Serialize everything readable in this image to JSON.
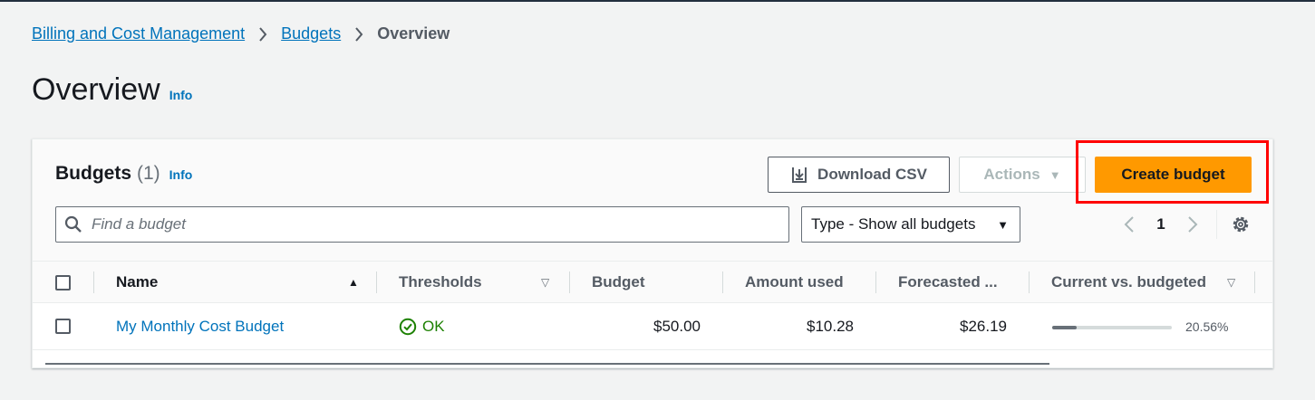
{
  "breadcrumb": {
    "items": [
      "Billing and Cost Management",
      "Budgets"
    ],
    "current": "Overview"
  },
  "page": {
    "title": "Overview",
    "info": "Info"
  },
  "panel": {
    "title": "Budgets",
    "count": "(1)",
    "info": "Info",
    "download_label": "Download CSV",
    "actions_label": "Actions",
    "create_label": "Create budget",
    "search_placeholder": "Find a budget",
    "type_filter": "Type - Show all budgets",
    "page_number": "1"
  },
  "table": {
    "headers": [
      "Name",
      "Thresholds",
      "Budget",
      "Amount used",
      "Forecasted ...",
      "Current vs. budgeted"
    ],
    "rows": [
      {
        "name": "My Monthly Cost Budget",
        "thresholds": "OK",
        "budget": "$50.00",
        "amount_used": "$10.28",
        "forecasted": "$26.19",
        "current_vs_budgeted": "20.56%",
        "progress_fraction": 0.2056
      }
    ]
  },
  "icons": {
    "breadcrumb_separator": "chevron-right-icon",
    "download": "download-icon",
    "actions_caret": "caret-down-icon",
    "search": "search-icon",
    "select_caret": "caret-down-icon",
    "prev": "chevron-left-icon",
    "next": "chevron-right-icon",
    "settings": "gear-icon",
    "sort_ascending": "sort-up-icon",
    "sort": "sort-down-icon",
    "status": "check-circle-icon"
  },
  "colors": {
    "primary_button": "#ff9900",
    "link": "#0073bb",
    "success": "#1d8102",
    "highlight": "#ff0000"
  }
}
